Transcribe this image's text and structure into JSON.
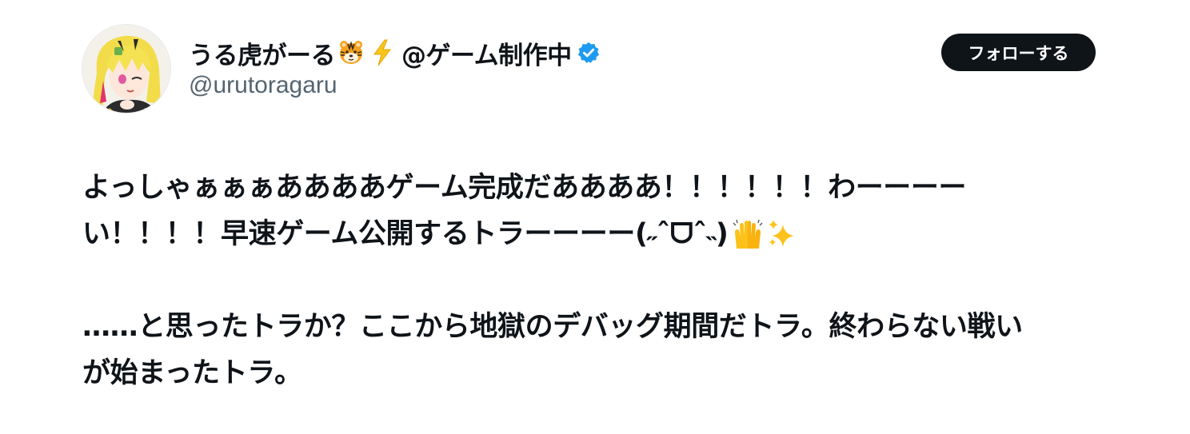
{
  "tweet": {
    "author": {
      "display_name": "うる虎がーる",
      "display_name_suffix": "@ゲーム制作中",
      "handle": "@urutoragaru",
      "verified": true,
      "name_emojis": [
        "tiger-face-emoji",
        "lightning-emoji"
      ],
      "verified_badge_color": "#1d9bf0"
    },
    "follow_button": {
      "label": "フォローする"
    },
    "body": {
      "line1": "よっしゃぁぁぁああああゲーム完成だああああ！！！！！！わーーーー",
      "line2": "い！！！！早速ゲーム公開するトラーーーー(˶ˆᗜˆ˵)",
      "line2_emojis": [
        "raising-hands-emoji",
        "sparkles-emoji"
      ],
      "line3": "……と思ったトラか？ここから地獄のデバッグ期間だトラ。終わらない戦い",
      "line4": "が始まったトラ。"
    }
  },
  "colors": {
    "text_primary": "#0f1419",
    "text_secondary": "#536471",
    "button_bg": "#0f1419",
    "button_text": "#ffffff",
    "verified": "#1d9bf0"
  }
}
